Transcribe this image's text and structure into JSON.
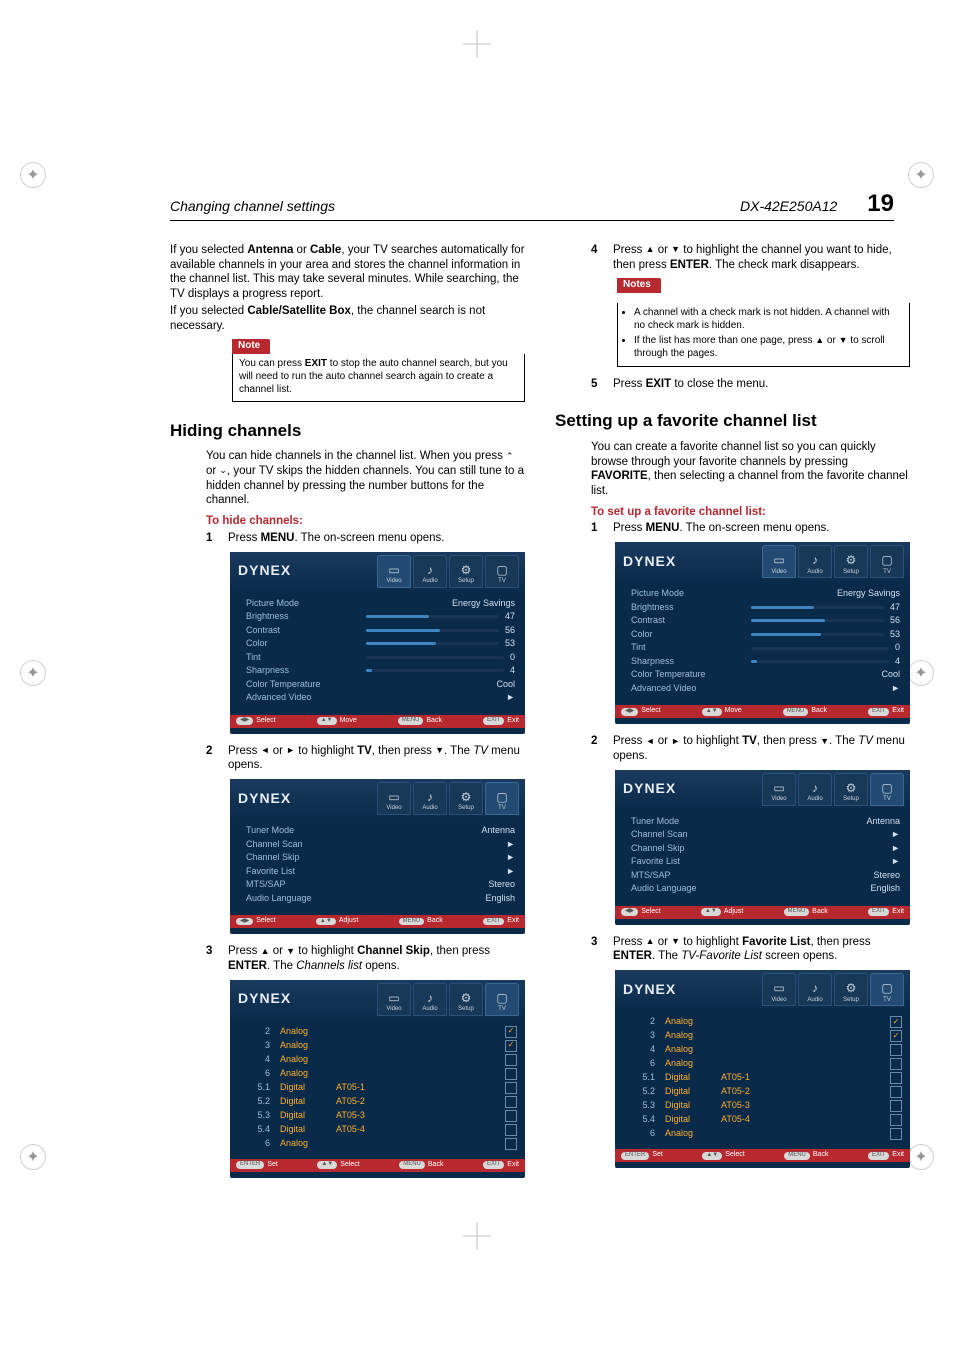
{
  "running_head": {
    "left": "Changing channel settings",
    "model": "DX-42E250A12",
    "pageno": "19"
  },
  "colA": {
    "para1": "If you selected <b>Antenna</b> or <b>Cable</b>, your TV searches automatically for available channels in your area and stores the channel information in the channel list. This may take several minutes. While searching, the TV displays a progress report.",
    "para2": "If you selected <b>Cable/Satellite Box</b>, the channel search is not necessary.",
    "note_label": "Note",
    "note_body": "You can press <b>EXIT</b> to stop the auto channel search, but you will need to run the auto channel search again to create a channel list.",
    "h_hiding": "Hiding channels",
    "hiding_lead": "You can hide channels in the channel list. When you press <span class=\"tri\">⌃</span> or <span class=\"tri\">⌄</span>, your TV skips the hidden channels. You can still tune to a hidden channel by pressing the number buttons for the channel.",
    "hiding_sub": "To hide channels:",
    "step1": "Press <b>MENU</b>. The on-screen menu opens.",
    "step2": "Press <span class=\"tri\">◄</span> or <span class=\"tri\">►</span> to highlight <b>TV</b>, then press <span class=\"tri\">▼</span>. The <i>TV</i> menu opens.",
    "step3": "Press <span class=\"tri\">▲</span> or <span class=\"tri\">▼</span> to highlight <b>Channel Skip</b>, then press <b>ENTER</b>. The <i>Channels list</i> opens."
  },
  "colB": {
    "step4": "Press <span class=\"tri\">▲</span> or <span class=\"tri\">▼</span> to highlight the channel you want to hide, then press <b>ENTER</b>. The check mark disappears.",
    "notes_label": "Notes",
    "notes_items": [
      "A channel with a check mark is not hidden. A channel with no check mark is hidden.",
      "If the list has more than one page, press <span class=\"tri\">▲</span> or <span class=\"tri\">▼</span> to scroll through the pages."
    ],
    "step5": "Press <b>EXIT</b> to close the menu.",
    "h_fav": "Setting up a favorite channel list",
    "fav_lead": "You can create a favorite channel list so you can quickly browse through your favorite channels by pressing <b>FAVORITE</b>, then selecting a channel from the favorite channel list.",
    "fav_sub": "To set up a favorite channel list:",
    "fstep1": "Press <b>MENU</b>. The on-screen menu opens.",
    "fstep2": "Press <span class=\"tri\">◄</span> or <span class=\"tri\">►</span> to highlight <b>TV</b>, then press <span class=\"tri\">▼</span>. The <i>TV</i> menu opens.",
    "fstep3": "Press <span class=\"tri\">▲</span> or <span class=\"tri\">▼</span> to highlight <b>Favorite List</b>, then press <b>ENTER</b>. The <i>TV-Favorite List</i> screen opens."
  },
  "osd": {
    "brand": "DYNEX",
    "tabs": [
      "Video",
      "Audio",
      "Setup",
      "TV"
    ],
    "video_rows": [
      {
        "label": "Picture Mode",
        "value": "Energy Savings"
      },
      {
        "label": "Brightness",
        "value": "47",
        "fill": 47
      },
      {
        "label": "Contrast",
        "value": "56",
        "fill": 56
      },
      {
        "label": "Color",
        "value": "53",
        "fill": 53
      },
      {
        "label": "Tint",
        "value": "0",
        "fill": 0
      },
      {
        "label": "Sharpness",
        "value": "4",
        "fill": 4
      },
      {
        "label": "Color Temperature",
        "value": "Cool"
      },
      {
        "label": "Advanced Video",
        "value": "►"
      }
    ],
    "tv_rows": [
      {
        "label": "Tuner Mode",
        "value": "Antenna"
      },
      {
        "label": "Channel Scan",
        "value": "►"
      },
      {
        "label": "Channel Skip",
        "value": "►"
      },
      {
        "label": "Favorite List",
        "value": "►"
      },
      {
        "label": "MTS/SAP",
        "value": "Stereo"
      },
      {
        "label": "Audio Language",
        "value": "English"
      }
    ],
    "channels": [
      {
        "num": "2",
        "type": "Analog",
        "name": "",
        "checked": true
      },
      {
        "num": "3",
        "type": "Analog",
        "name": "",
        "checked": true
      },
      {
        "num": "4",
        "type": "Analog",
        "name": "",
        "checked": false
      },
      {
        "num": "6",
        "type": "Analog",
        "name": "",
        "checked": false
      },
      {
        "num": "5.1",
        "type": "Digital",
        "name": "AT05-1",
        "checked": false
      },
      {
        "num": "5.2",
        "type": "Digital",
        "name": "AT05-2",
        "checked": false
      },
      {
        "num": "5.3",
        "type": "Digital",
        "name": "AT05-3",
        "checked": false
      },
      {
        "num": "5.4",
        "type": "Digital",
        "name": "AT05-4",
        "checked": false
      },
      {
        "num": "6",
        "type": "Analog",
        "name": "",
        "checked": false
      }
    ],
    "foot": {
      "select": "Select",
      "move": "Move",
      "adjust": "Adjust",
      "back": "Back",
      "exit": "Exit",
      "set": "Set"
    }
  }
}
